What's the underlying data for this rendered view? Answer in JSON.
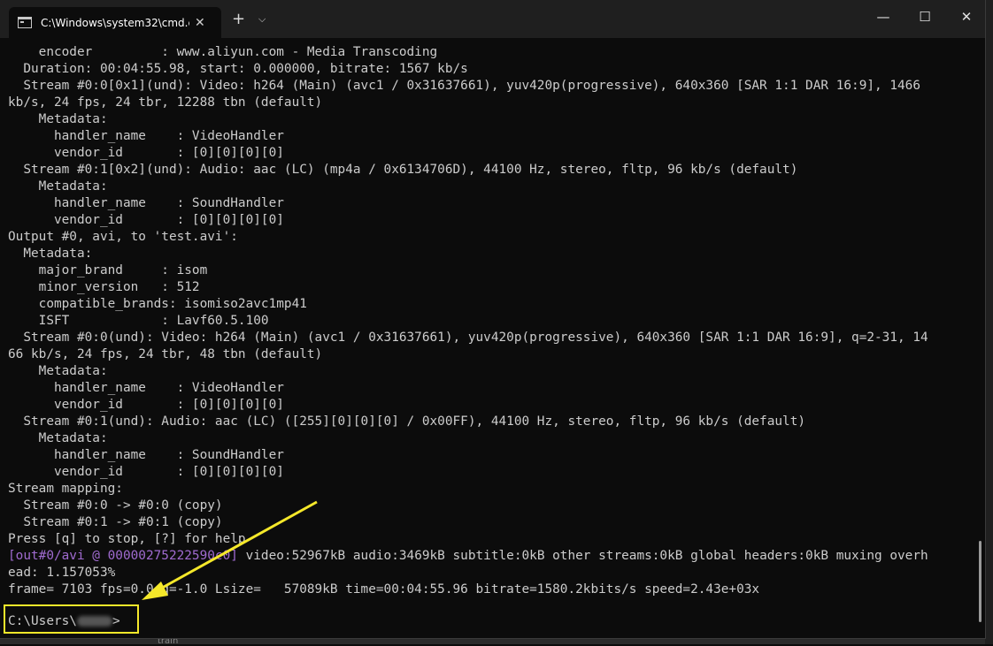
{
  "window": {
    "tab_title": "C:\\Windows\\system32\\cmd.e:",
    "tab_close": "✕",
    "new_tab": "+",
    "dropdown": "⌵",
    "minimize": "—",
    "maximize": "☐",
    "close": "✕"
  },
  "console": {
    "lines": [
      "    encoder         : www.aliyun.com - Media Transcoding",
      "  Duration: 00:04:55.98, start: 0.000000, bitrate: 1567 kb/s",
      "  Stream #0:0[0x1](und): Video: h264 (Main) (avc1 / 0x31637661), yuv420p(progressive), 640x360 [SAR 1:1 DAR 16:9], 1466",
      "kb/s, 24 fps, 24 tbr, 12288 tbn (default)",
      "    Metadata:",
      "      handler_name    : VideoHandler",
      "      vendor_id       : [0][0][0][0]",
      "  Stream #0:1[0x2](und): Audio: aac (LC) (mp4a / 0x6134706D), 44100 Hz, stereo, fltp, 96 kb/s (default)",
      "    Metadata:",
      "      handler_name    : SoundHandler",
      "      vendor_id       : [0][0][0][0]",
      "Output #0, avi, to 'test.avi':",
      "  Metadata:",
      "    major_brand     : isom",
      "    minor_version   : 512",
      "    compatible_brands: isomiso2avc1mp41",
      "    ISFT            : Lavf60.5.100",
      "  Stream #0:0(und): Video: h264 (Main) (avc1 / 0x31637661), yuv420p(progressive), 640x360 [SAR 1:1 DAR 16:9], q=2-31, 14",
      "66 kb/s, 24 fps, 24 tbr, 48 tbn (default)",
      "    Metadata:",
      "      handler_name    : VideoHandler",
      "      vendor_id       : [0][0][0][0]",
      "  Stream #0:1(und): Audio: aac (LC) ([255][0][0][0] / 0x00FF), 44100 Hz, stereo, fltp, 96 kb/s (default)",
      "    Metadata:",
      "      handler_name    : SoundHandler",
      "      vendor_id       : [0][0][0][0]",
      "Stream mapping:",
      "  Stream #0:0 -> #0:0 (copy)",
      "  Stream #0:1 -> #0:1 (copy)",
      "Press [q] to stop, [?] for help"
    ],
    "out_prefix": "[out#0/avi @ 00000275222590c0]",
    "out_rest": " video:52967kB audio:3469kB subtitle:0kB other streams:0kB global headers:0kB muxing overh",
    "after_lines": [
      "ead: 1.157053%",
      "frame= 7103 fps=0.0 q=-1.0 Lsize=   57089kB time=00:04:55.96 bitrate=1580.2kbits/s speed=2.43e+03x"
    ],
    "prompt_prefix": "C:\\Users\\",
    "prompt_suffix": ">"
  },
  "background": {
    "text": "train"
  },
  "colors": {
    "console_bg": "#0c0c0c",
    "text": "#cccccc",
    "purple": "#a06bd0",
    "highlight": "#f5e82a"
  }
}
